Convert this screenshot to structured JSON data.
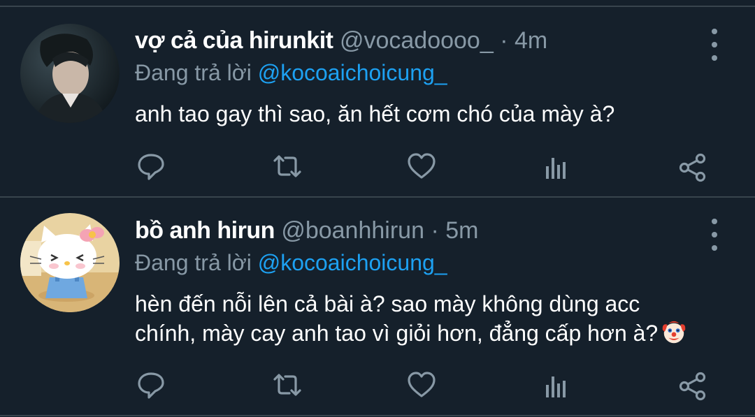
{
  "tweets": [
    {
      "display_name": "vợ cả của hirunkit",
      "handle": "@vocadoooo_",
      "separator": "·",
      "time": "4m",
      "reply_prefix": "Đang trả lời",
      "reply_to": "@kocoaichoicung_",
      "text_lines": [
        "anh tao gay thì sao, ăn hết cơm chó của mày à?"
      ],
      "avatar": "young man portrait, dark background"
    },
    {
      "display_name": "bồ anh hirun",
      "handle": "@boanhhirun",
      "separator": "·",
      "time": "5m",
      "reply_prefix": "Đang trả lời",
      "reply_to": "@kocoaichoicung_",
      "text_lines": [
        "hèn đến nỗi lên cả bài à? sao mày không dùng acc",
        "chính, mày cay anh tao vì giỏi hơn, đẳng cấp hơn à?"
      ],
      "emoji": "clown-face",
      "avatar": "hello kitty character with pink bow and blue overalls"
    }
  ],
  "actions": [
    "reply-icon",
    "retweet-icon",
    "like-icon",
    "analytics-icon",
    "share-icon"
  ],
  "colors": {
    "background": "#15202b",
    "divider": "#38444d",
    "secondary_text": "#8899a6",
    "mention": "#1da1f2",
    "primary_text": "#ffffff"
  }
}
